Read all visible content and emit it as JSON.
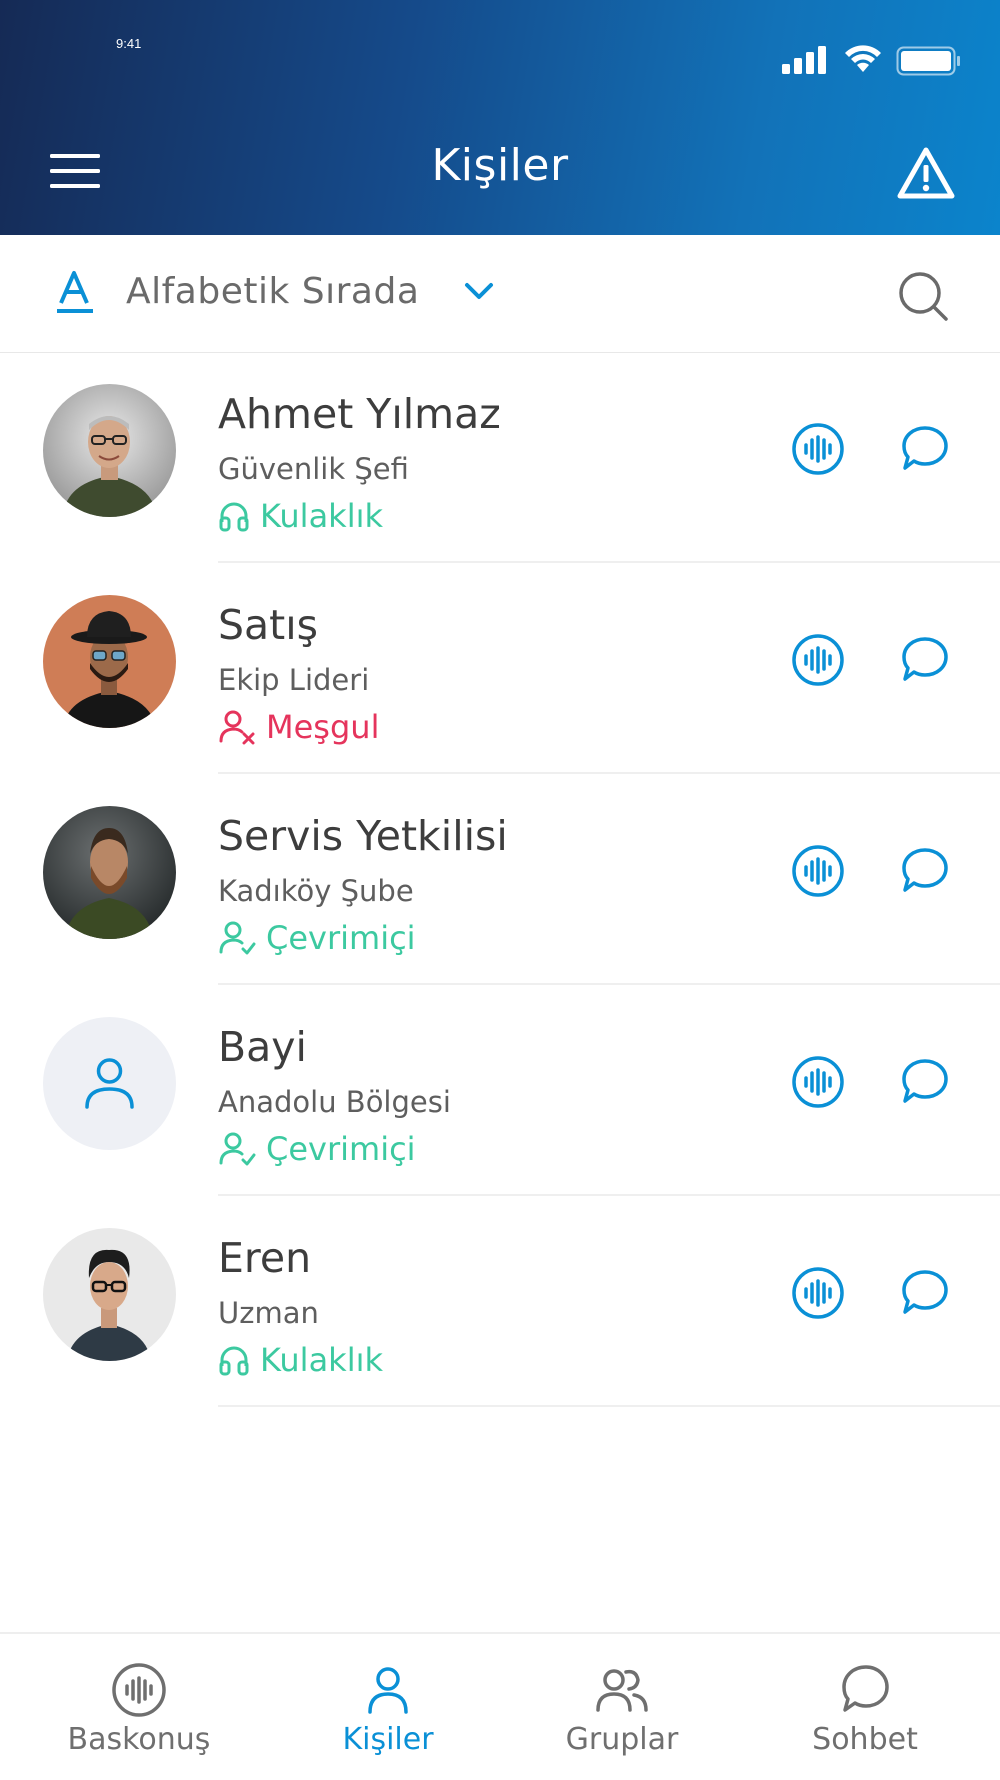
{
  "status_bar": {
    "time": "9:41"
  },
  "header": {
    "title": "Kişiler"
  },
  "sort": {
    "label": "Alfabetik Sırada"
  },
  "contacts": [
    {
      "name": "Ahmet Yılmaz",
      "role": "Güvenlik Şefi",
      "status": "Kulaklık",
      "status_type": "headset"
    },
    {
      "name": "Satış",
      "role": "Ekip Lideri",
      "status": "Meşgul",
      "status_type": "busy"
    },
    {
      "name": "Servis Yetkilisi",
      "role": "Kadıköy Şube",
      "status": "Çevrimiçi",
      "status_type": "online"
    },
    {
      "name": "Bayi",
      "role": "Anadolu Bölgesi",
      "status": "Çevrimiçi",
      "status_type": "online"
    },
    {
      "name": "Eren",
      "role": "Uzman",
      "status": "Kulaklık",
      "status_type": "headset"
    }
  ],
  "nav": [
    {
      "label": "Baskonuş",
      "icon": "push-to-talk-icon",
      "active": false
    },
    {
      "label": "Kişiler",
      "icon": "person-icon",
      "active": true
    },
    {
      "label": "Gruplar",
      "icon": "group-icon",
      "active": false
    },
    {
      "label": "Sohbet",
      "icon": "chat-bubble-icon",
      "active": false
    }
  ],
  "colors": {
    "accent": "#0a90d6",
    "online": "#3cc9a0",
    "busy": "#e5345c",
    "header_start": "#152a55",
    "header_end": "#0b84cc"
  }
}
